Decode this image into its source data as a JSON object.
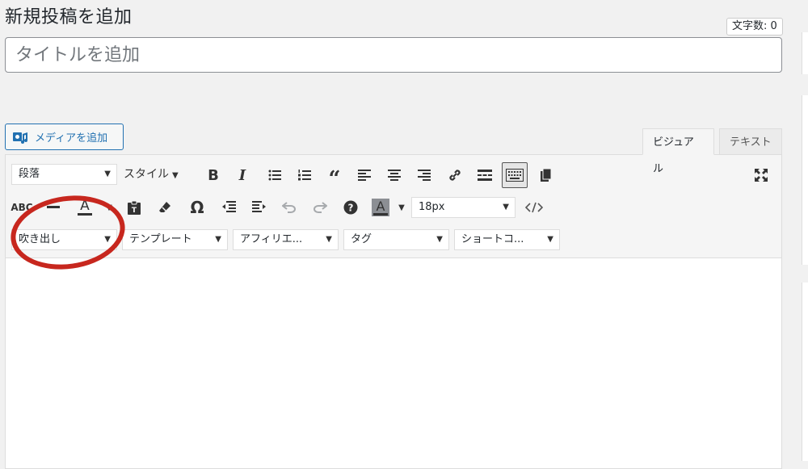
{
  "header": {
    "title": "新規投稿を追加",
    "word_count": "文字数: 0"
  },
  "title_field": {
    "placeholder": "タイトルを追加",
    "value": ""
  },
  "media_button": {
    "label": "メディアを追加"
  },
  "tabs": [
    {
      "label": "ビジュアル",
      "active": true
    },
    {
      "label": "テキスト",
      "active": false
    }
  ],
  "toolbar": {
    "row1": {
      "format_select": "段落",
      "style_menu": "スタイル",
      "buttons": [
        "bold-icon",
        "italic-icon",
        "bullet-list-icon",
        "numbered-list-icon",
        "blockquote-icon",
        "align-left-icon",
        "align-center-icon",
        "align-right-icon",
        "link-icon",
        "read-more-icon",
        "toolbar-toggle-icon",
        "copy-icon",
        "fullscreen-icon"
      ]
    },
    "row2": {
      "buttons": [
        "strikethrough-icon",
        "horizontal-rule-icon",
        "text-color-icon",
        "paste-text-icon",
        "clear-formatting-icon",
        "special-character-icon",
        "outdent-icon",
        "indent-icon",
        "undo-icon",
        "redo-icon",
        "help-icon",
        "background-color-icon",
        "code-icon"
      ],
      "font_size": "18px"
    },
    "row3": {
      "selects": [
        "吹き出し",
        "テンプレート",
        "アフィリエ...",
        "タグ",
        "ショートコ..."
      ]
    }
  },
  "annotation": {
    "color": "#c7271e"
  },
  "colors": {
    "accent": "#2271b1",
    "background": "#f1f1f1"
  }
}
